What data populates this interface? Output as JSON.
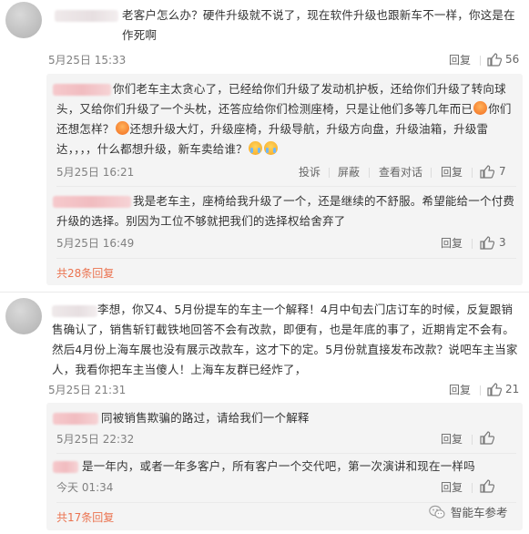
{
  "comment1": {
    "text": "老客户怎么办？硬件升级就不说了，现在软件升级也跟新车不一样，你这是在作死啊",
    "time": "5月25日 15:33",
    "reply_label": "回复",
    "like_count": "56",
    "replies": [
      {
        "text_a": "你们老车主太贪心了，已经给你们升级了发动机护板，还给你们升级了转向球头，又给你们升级了一个头枕，还答应给你们检测座椅，只是让他们多等几年而已",
        "text_b": "你们还想怎样？",
        "text_c": "还想升级大灯，升级座椅，升级导航，升级方向盘，升级油箱，升级雷达，，，，什么都想升级，新车卖给谁？",
        "time": "5月25日 16:21",
        "actions": [
          "投诉",
          "屏蔽",
          "查看对话",
          "回复"
        ],
        "like_count": "7"
      },
      {
        "text": "我是老车主，座椅给我升级了一个，还是继续的不舒服。希望能给一个付费升级的选择。别因为工位不够就把我们的选择权给舍弃了",
        "time": "5月25日 16:49",
        "reply_label": "回复",
        "like_count": "3"
      }
    ],
    "more_replies": "共28条回复"
  },
  "comment2": {
    "text": "李想，你又4、5月份提车的车主一个解释！4月中旬去门店订车的时候，反复跟销售确认了，销售斩钉截铁地回答不会有改款，即便有，也是年底的事了，近期肯定不会有。然后4月份上海车展也没有展示改款车，这才下的定。5月份就直接发布改款？说吧车主当家人，我看你把车主当傻人！上海车友群已经炸了，",
    "time": "5月25日 21:31",
    "reply_label": "回复",
    "like_count": "21",
    "replies": [
      {
        "text": "同被销售欺骗的路过，请给我们一个解释",
        "time": "5月25日 22:32",
        "reply_label": "回复",
        "like_count": ""
      },
      {
        "text": "是一年内，或者一年多客户，所有客户一个交代吧，第一次演讲和现在一样吗",
        "time": "今天 01:34",
        "reply_label": "回复",
        "like_count": ""
      }
    ],
    "more_replies": "共17条回复"
  },
  "watermark": "智能车参考",
  "icons": {
    "like": "thumbs-up-icon",
    "wechat": "wechat-icon",
    "emoji_angry": "angry-face-icon",
    "emoji_cry": "crying-face-icon"
  },
  "colors": {
    "accent": "#eb7350",
    "reply_bg": "#f4f4f4",
    "meta": "#808080"
  }
}
